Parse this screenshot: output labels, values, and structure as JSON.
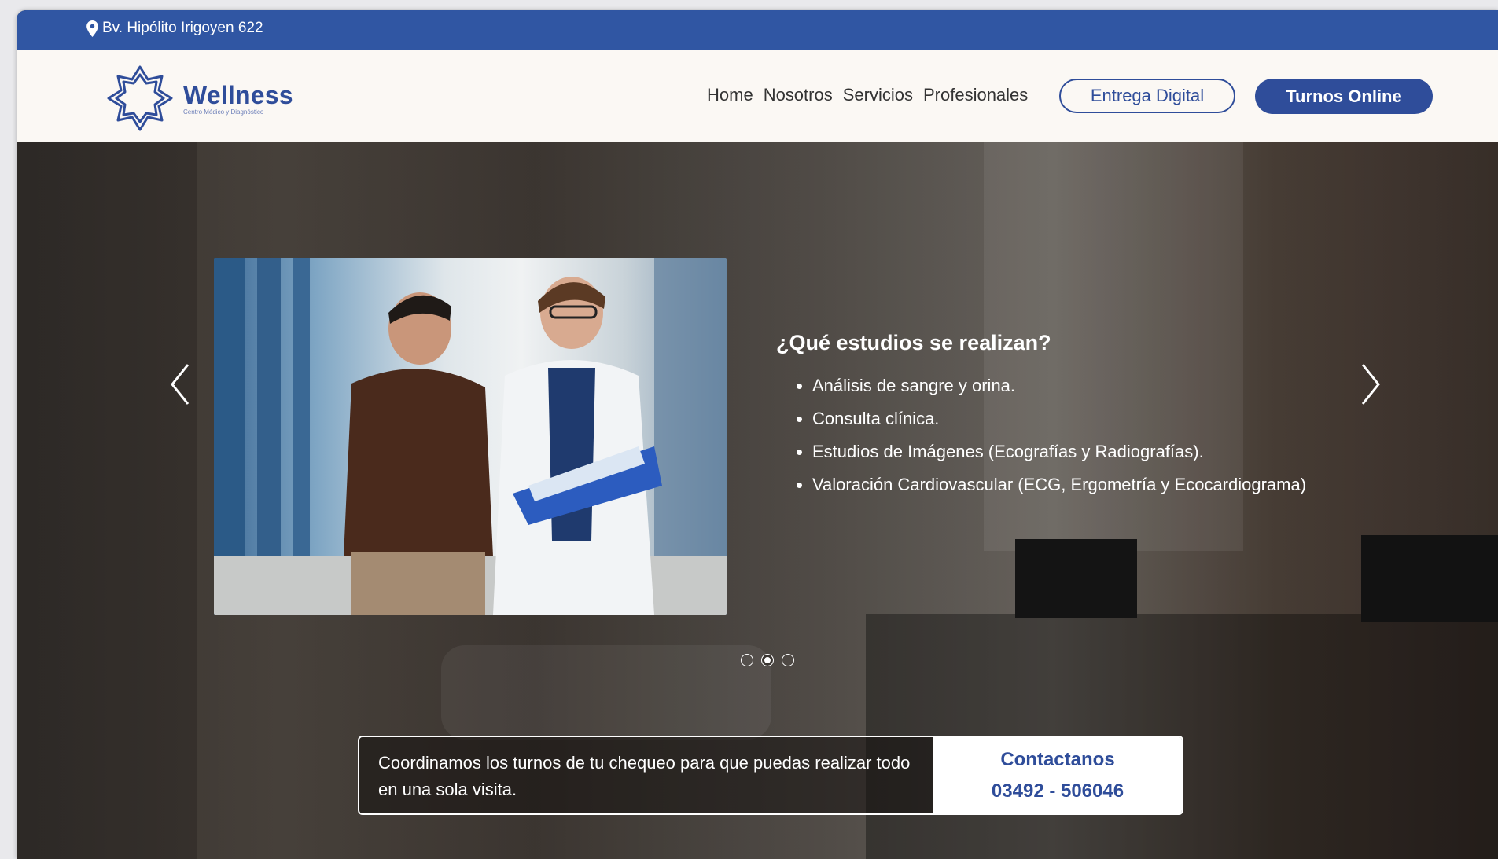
{
  "topbar": {
    "address": "Bv. Hipólito Irigoyen 622"
  },
  "brand": {
    "name": "Wellness",
    "tagline": "Centro Médico y Diagnóstico"
  },
  "nav": {
    "items": [
      {
        "label": "Home"
      },
      {
        "label": "Nosotros"
      },
      {
        "label": "Servicios"
      },
      {
        "label": "Profesionales"
      }
    ],
    "entrega_label": "Entrega Digital",
    "turnos_label": "Turnos Online"
  },
  "slide": {
    "title": "¿Qué estudios se realizan?",
    "items": [
      "Análisis de sangre y orina.",
      "Consulta clínica.",
      "Estudios de Imágenes (Ecografías y Radiografías).",
      "Valoración Cardiovascular (ECG, Ergometría y Ecocardiograma)"
    ],
    "active_index": 1,
    "count": 3
  },
  "cta": {
    "text": "Coordinamos los turnos de tu chequeo para que puedas realizar todo en una sola visita.",
    "contact_label": "Contactanos",
    "phone": "03492 - 506046"
  },
  "colors": {
    "brand": "#2f4d9a",
    "topbar": "#3056a3"
  }
}
